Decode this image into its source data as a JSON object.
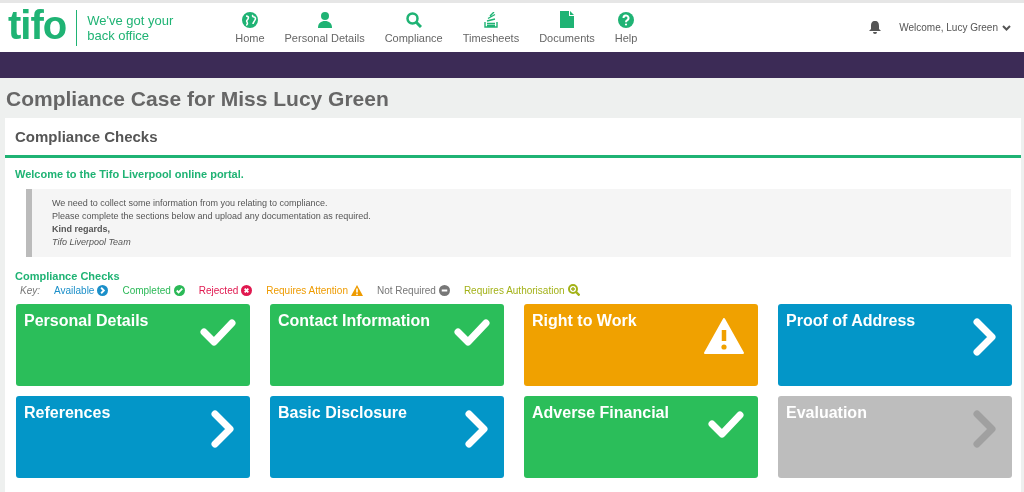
{
  "header": {
    "logo": "tifo",
    "tagline_lines": [
      "We've got your",
      "back office"
    ],
    "nav": [
      {
        "label": "Home",
        "kind": "globe"
      },
      {
        "label": "Personal Details",
        "kind": "person"
      },
      {
        "label": "Compliance",
        "kind": "search"
      },
      {
        "label": "Timesheets",
        "kind": "stack"
      },
      {
        "label": "Documents",
        "kind": "document"
      },
      {
        "label": "Help",
        "kind": "help"
      }
    ],
    "user_menu": "Welcome, Lucy Green"
  },
  "page_title": "Compliance Case for Miss Lucy Green",
  "panel": {
    "title": "Compliance Checks",
    "welcome": "Welcome to the Tifo Liverpool online portal.",
    "message": {
      "lines": [
        "We need to collect some information from you relating to compliance.",
        "Please complete the sections below and upload any documentation as required."
      ],
      "closing": "Kind regards,",
      "signature": "Tifo Liverpool Team"
    },
    "checks_heading": "Compliance Checks",
    "key_label": "Key:",
    "key": [
      {
        "label": "Available",
        "kind": "available"
      },
      {
        "label": "Completed",
        "kind": "completed"
      },
      {
        "label": "Rejected",
        "kind": "rejected"
      },
      {
        "label": "Requires Attention",
        "kind": "attention"
      },
      {
        "label": "Not Required",
        "kind": "not_required"
      },
      {
        "label": "Requires Authorisation",
        "kind": "authorisation"
      }
    ],
    "tiles": [
      {
        "label": "Personal Details",
        "kind": "completed"
      },
      {
        "label": "Contact Information",
        "kind": "completed"
      },
      {
        "label": "Right to Work",
        "kind": "attention"
      },
      {
        "label": "Proof of Address",
        "kind": "available"
      },
      {
        "label": "References",
        "kind": "available"
      },
      {
        "label": "Basic Disclosure",
        "kind": "available"
      },
      {
        "label": "Adverse Financial",
        "kind": "completed"
      },
      {
        "label": "Evaluation",
        "kind": "locked"
      }
    ]
  }
}
